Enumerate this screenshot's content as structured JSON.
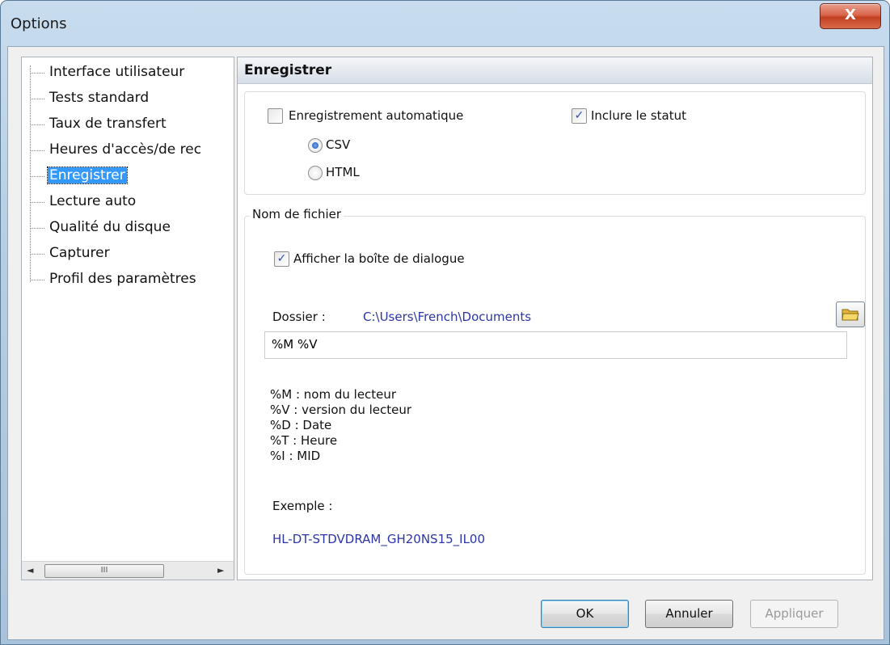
{
  "window": {
    "title": "Options",
    "close_glyph": "X"
  },
  "tree": {
    "items": [
      "Interface utilisateur",
      "Tests standard",
      "Taux de transfert",
      "Heures d'accès/de rec",
      "Enregistrer",
      "Lecture auto",
      "Qualité du disque",
      "Capturer",
      "Profil des paramètres"
    ],
    "selected_index": 4,
    "scroll": {
      "thumb_glyph": "III",
      "left_arrow": "◄",
      "right_arrow": "►"
    }
  },
  "panel": {
    "header": "Enregistrer",
    "auto_save": {
      "label": "Enregistrement automatique",
      "checked": false
    },
    "include_status": {
      "label": "Inclure le statut",
      "checked": true
    },
    "format": {
      "options": [
        "CSV",
        "HTML"
      ],
      "selected": "CSV"
    },
    "filename_group": {
      "legend": "Nom de fichier",
      "show_dialog": {
        "label": "Afficher la boîte de dialogue",
        "checked": true
      },
      "folder_label": "Dossier :",
      "folder_path": "C:\\Users\\French\\Documents",
      "pattern_value": "%M %V",
      "legend_lines": [
        "%M : nom du lecteur",
        "%V : version du lecteur",
        "%D : Date",
        "%T : Heure",
        "%I : MID"
      ],
      "example_label": "Exemple :",
      "example_value": "HL-DT-STDVDRAM_GH20NS15_IL00"
    }
  },
  "buttons": {
    "ok": "OK",
    "cancel": "Annuler",
    "apply": "Appliquer"
  },
  "colors": {
    "selection": "#3399ff",
    "link_blue": "#2c35a6",
    "close_red": "#c33f22"
  }
}
